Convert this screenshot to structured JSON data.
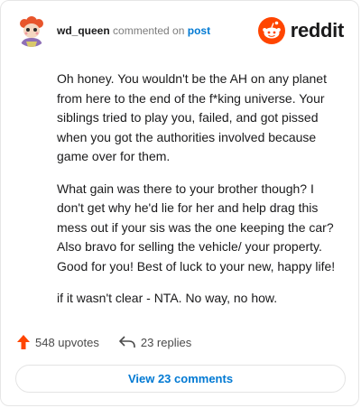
{
  "comment": {
    "username": "wd_queen",
    "commented_on": "commented on",
    "post_link": "post",
    "brand": "reddit",
    "paragraphs": [
      "Oh honey. You wouldn't be the AH on any planet from here to the end of the f*king universe. Your siblings tried to play you, failed, and got pissed when you got the authorities involved because game over for them.",
      "What gain was there to your brother though? I don't get why he'd lie for her and help drag this mess out if your sis was the one keeping the car? Also bravo for selling the vehicle/ your property. Good for you! Best of luck to your new, happy life!",
      "if it wasn't clear - NTA. No way, no how."
    ]
  },
  "actions": {
    "upvotes": "548 upvotes",
    "replies": "23 replies",
    "view_comments": "View 23 comments"
  },
  "colors": {
    "upvote": "#ff4500",
    "link": "#0079d3",
    "brand": "#ff4500"
  },
  "icons": [
    "avatar",
    "reddit-logo-icon",
    "upvote-icon",
    "reply-icon"
  ]
}
